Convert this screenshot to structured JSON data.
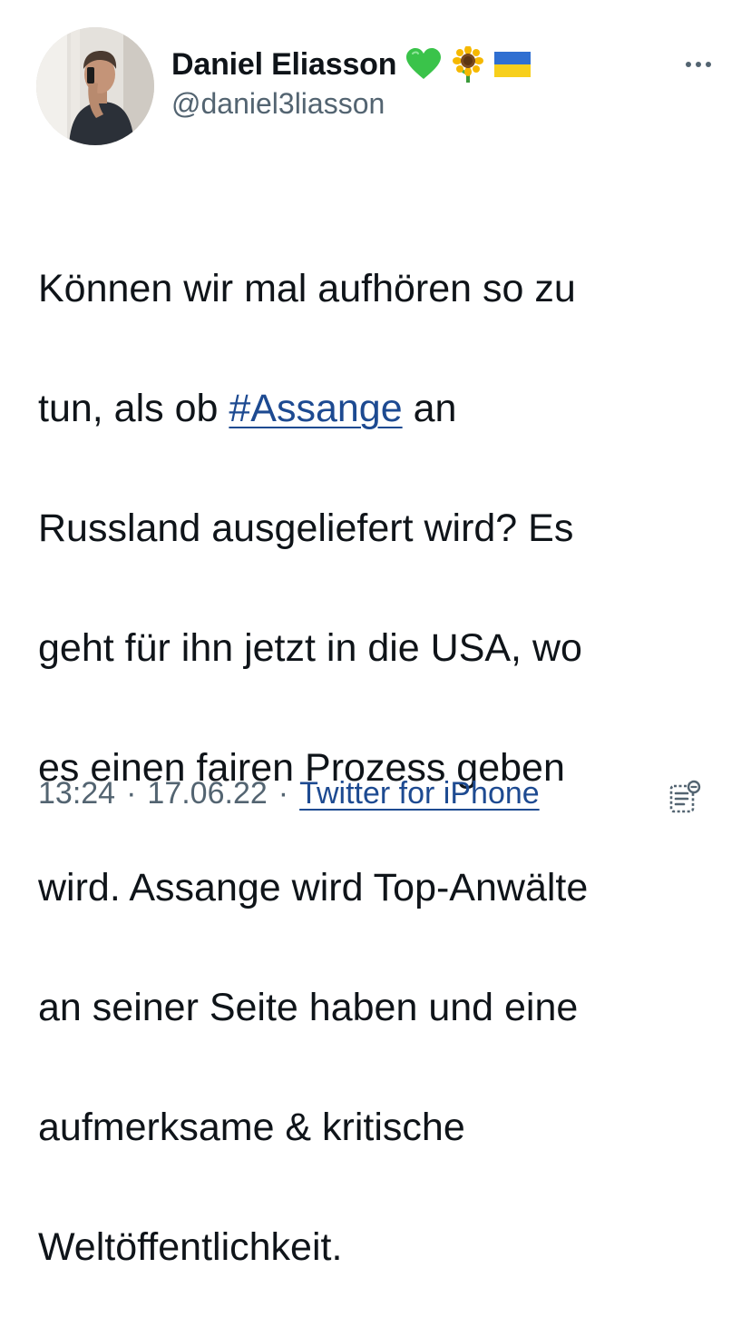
{
  "author": {
    "display_name": "Daniel Eliasson",
    "handle": "@daniel3liasson",
    "name_emojis": [
      "green-heart-icon",
      "sunflower-icon",
      "ukraine-flag-icon"
    ]
  },
  "tweet": {
    "lines": [
      {
        "text": "Können wir mal aufhören so zu"
      },
      {
        "before": "tun, als ob ",
        "hashtag": "#Assange",
        "after": " an"
      },
      {
        "text": "Russland ausgeliefert wird? Es"
      },
      {
        "text": "geht für ihn jetzt in die USA, wo"
      },
      {
        "text": "es einen fairen Prozess geben"
      },
      {
        "text": "wird. Assange wird Top-Anwälte"
      },
      {
        "text": "an seiner Seite haben und eine"
      },
      {
        "text": "aufmerksame & kritische"
      },
      {
        "text": "Weltöffentlichkeit."
      }
    ]
  },
  "meta": {
    "time": "13:24",
    "separator": "·",
    "date": "17.06.22",
    "source": "Twitter for iPhone"
  },
  "colors": {
    "text": "#0f1419",
    "secondary": "#536471",
    "link": "#1d4a91"
  },
  "icons": {
    "more": "more-horizontal-icon",
    "analytics": "view-tweet-analytics-icon"
  }
}
